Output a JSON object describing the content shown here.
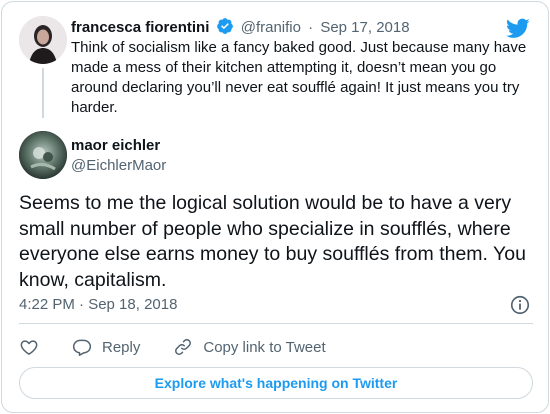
{
  "parent_tweet": {
    "name": "francesca fiorentini",
    "handle": "@franifio",
    "separator": "·",
    "date": "Sep 17, 2018",
    "text": "Think of socialism like a fancy baked good. Just because many have made a mess of their kitchen attempting it, doesn’t mean you go around declaring you’ll never eat soufflé again! It just means you try harder.",
    "verified": true
  },
  "main_tweet": {
    "name": "maor eichler",
    "handle": "@EichlerMaor",
    "text": "Seems to me the logical solution would be to have a very small number of people who specialize in soufflés, where everyone else earns money to buy soufflés from them. You know, capitalism.",
    "timestamp": "4:22 PM · Sep 18, 2018"
  },
  "actions": {
    "reply_label": "Reply",
    "copy_label": "Copy link to Tweet"
  },
  "explore_label": "Explore what's happening on Twitter",
  "colors": {
    "accent": "#1d9bf0",
    "text": "#0f1419",
    "muted": "#536471",
    "border": "#cfd9de"
  },
  "icons": [
    "twitter-bird-icon",
    "verified-badge-icon",
    "info-icon",
    "heart-icon",
    "reply-icon",
    "link-icon"
  ]
}
